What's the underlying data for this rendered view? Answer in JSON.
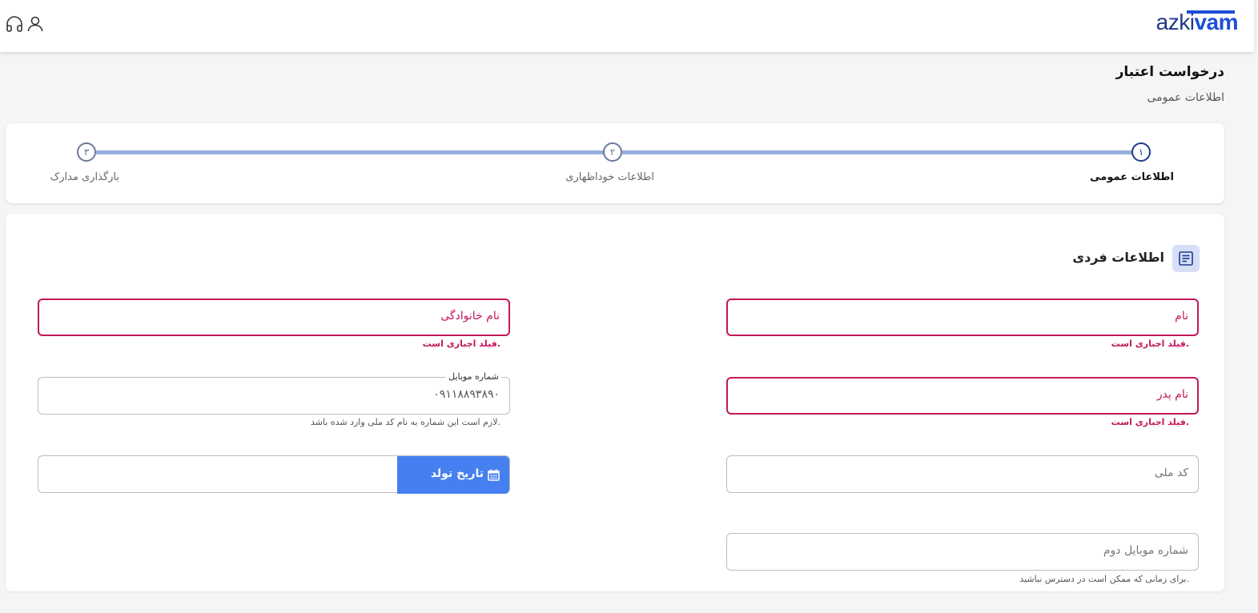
{
  "header": {
    "logo_prefix": "azki",
    "logo_suffix": "vam",
    "icons": [
      "user-icon",
      "headset-icon"
    ]
  },
  "page": {
    "title": "درخواست اعتبار",
    "subtitle": "اطلاعات عمومی"
  },
  "stepper": {
    "steps": [
      {
        "number": "۱",
        "label": "اطلاعات عمومی",
        "active": true
      },
      {
        "number": "۲",
        "label": "اطلاعات خوداظهاری",
        "active": false
      },
      {
        "number": "۳",
        "label": "بارگذاری مدارک",
        "active": false
      }
    ]
  },
  "section": {
    "title": "اطلاعات فردی",
    "icon": "document-icon"
  },
  "form": {
    "first_name": {
      "placeholder": "نام",
      "error": "فیلد اجباری است."
    },
    "last_name": {
      "placeholder": "نام خانوادگی",
      "error": "فیلد اجباری است."
    },
    "father_name": {
      "placeholder": "نام پدر",
      "error": "فیلد اجباری است."
    },
    "mobile": {
      "label": "شماره موبایل",
      "value": "۰۹۱۱۸۸۹۳۸۹۰",
      "help": "لازم است این شماره به نام کد ملی وارد شده باشد."
    },
    "national_code": {
      "placeholder": "کد ملی"
    },
    "birth_date": {
      "button_label": "تاریخ تولد",
      "value": ""
    },
    "second_mobile": {
      "placeholder": "شماره موبایل دوم",
      "help": "برای زمانی که ممکن است در دسترس نباشید."
    }
  },
  "colors": {
    "brand": "#1e3a8a",
    "accent": "#4680f0",
    "error": "#c2185b",
    "stepper_line": "#98aedd"
  }
}
